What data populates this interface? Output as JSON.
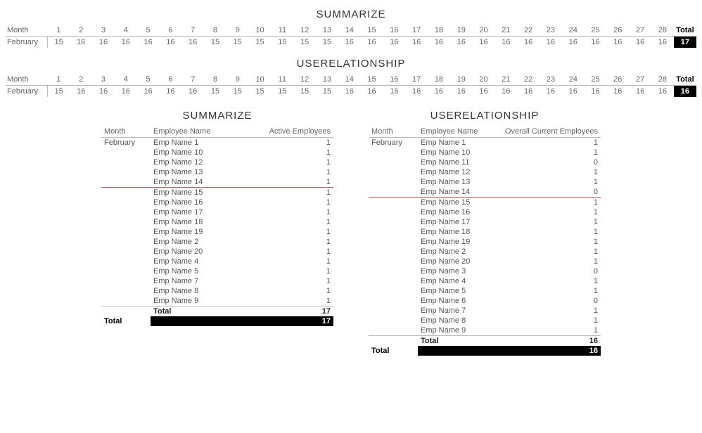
{
  "labels": {
    "month": "Month",
    "total": "Total",
    "employee_name": "Employee Name",
    "active_employees": "Active Employees",
    "overall_current_employees": "Overall Current Employees"
  },
  "top": [
    {
      "title": "SUMMARIZE",
      "month": "February",
      "days": [
        1,
        2,
        3,
        4,
        5,
        6,
        7,
        8,
        9,
        10,
        11,
        12,
        13,
        14,
        15,
        16,
        17,
        18,
        19,
        20,
        21,
        22,
        23,
        24,
        25,
        26,
        27,
        28
      ],
      "values": [
        15,
        16,
        16,
        16,
        16,
        16,
        16,
        15,
        15,
        15,
        15,
        15,
        15,
        16,
        16,
        16,
        16,
        16,
        16,
        16,
        16,
        16,
        16,
        16,
        16,
        16,
        16,
        16
      ],
      "total": 17
    },
    {
      "title": "USERELATIONSHIP",
      "month": "February",
      "days": [
        1,
        2,
        3,
        4,
        5,
        6,
        7,
        8,
        9,
        10,
        11,
        12,
        13,
        14,
        15,
        16,
        17,
        18,
        19,
        20,
        21,
        22,
        23,
        24,
        25,
        26,
        27,
        28
      ],
      "values": [
        15,
        16,
        16,
        16,
        16,
        16,
        16,
        15,
        15,
        15,
        15,
        15,
        15,
        16,
        16,
        16,
        16,
        16,
        16,
        16,
        16,
        16,
        16,
        16,
        16,
        16,
        16,
        16
      ],
      "total": 16
    }
  ],
  "left": {
    "title": "SUMMARIZE",
    "month": "February",
    "value_label_key": "active_employees",
    "rows": [
      {
        "name": "Emp Name 1",
        "v": 1
      },
      {
        "name": "Emp Name 10",
        "v": 1
      },
      {
        "name": "Emp Name 12",
        "v": 1
      },
      {
        "name": "Emp Name 13",
        "v": 1
      },
      {
        "name": "Emp Name 14",
        "v": 1,
        "redline": true
      },
      {
        "name": "Emp Name 15",
        "v": 1
      },
      {
        "name": "Emp Name 16",
        "v": 1
      },
      {
        "name": "Emp Name 17",
        "v": 1
      },
      {
        "name": "Emp Name 18",
        "v": 1
      },
      {
        "name": "Emp Name 19",
        "v": 1
      },
      {
        "name": "Emp Name 2",
        "v": 1
      },
      {
        "name": "Emp Name 20",
        "v": 1
      },
      {
        "name": "Emp Name 4",
        "v": 1
      },
      {
        "name": "Emp Name 5",
        "v": 1
      },
      {
        "name": "Emp Name 7",
        "v": 1
      },
      {
        "name": "Emp Name 8",
        "v": 1
      },
      {
        "name": "Emp Name 9",
        "v": 1
      }
    ],
    "subtotal": 17,
    "grand": 17
  },
  "right": {
    "title": "USERELATIONSHIP",
    "month": "February",
    "value_label_key": "overall_current_employees",
    "rows": [
      {
        "name": "Emp Name 1",
        "v": 1
      },
      {
        "name": "Emp Name 10",
        "v": 1
      },
      {
        "name": "Emp Name 11",
        "v": 0
      },
      {
        "name": "Emp Name 12",
        "v": 1
      },
      {
        "name": "Emp Name 13",
        "v": 1
      },
      {
        "name": "Emp Name 14",
        "v": 0,
        "redline": true
      },
      {
        "name": "Emp Name 15",
        "v": 1
      },
      {
        "name": "Emp Name 16",
        "v": 1
      },
      {
        "name": "Emp Name 17",
        "v": 1
      },
      {
        "name": "Emp Name 18",
        "v": 1
      },
      {
        "name": "Emp Name 19",
        "v": 1
      },
      {
        "name": "Emp Name 2",
        "v": 1
      },
      {
        "name": "Emp Name 20",
        "v": 1
      },
      {
        "name": "Emp Name 3",
        "v": 0
      },
      {
        "name": "Emp Name 4",
        "v": 1
      },
      {
        "name": "Emp Name 5",
        "v": 1
      },
      {
        "name": "Emp Name 6",
        "v": 0
      },
      {
        "name": "Emp Name 7",
        "v": 1
      },
      {
        "name": "Emp Name 8",
        "v": 1
      },
      {
        "name": "Emp Name 9",
        "v": 1
      }
    ],
    "subtotal": 16,
    "grand": 16
  }
}
